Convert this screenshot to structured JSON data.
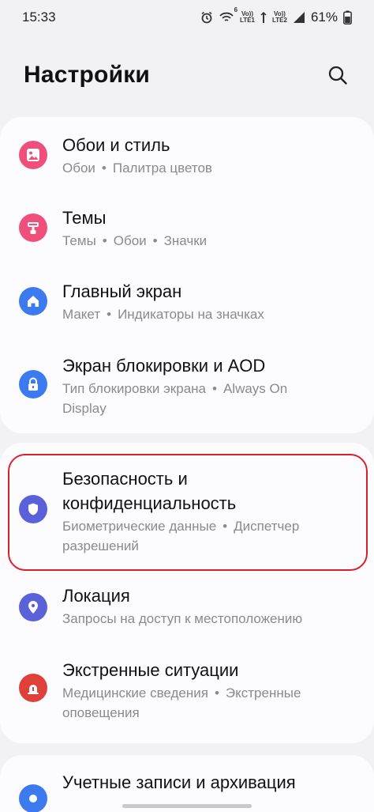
{
  "status_bar": {
    "time": "15:33",
    "network_1": "Vo))",
    "network_1_sub": "LTE1",
    "network_2": "Vo))",
    "network_2_sub": "LTE2",
    "wifi_badge": "6",
    "battery": "61%"
  },
  "header": {
    "title": "Настройки"
  },
  "settings": [
    {
      "title": "Обои и стиль",
      "subtitle": [
        "Обои",
        "Палитра цветов"
      ],
      "icon": "wallpaper-icon",
      "color": "#f04f7c"
    },
    {
      "title": "Темы",
      "subtitle": [
        "Темы",
        "Обои",
        "Значки"
      ],
      "icon": "themes-icon",
      "color": "#f04f7c"
    },
    {
      "title": "Главный экран",
      "subtitle": [
        "Макет",
        "Индикаторы на значках"
      ],
      "icon": "home-icon",
      "color": "#3d7af0"
    },
    {
      "title": "Экран блокировки и AOD",
      "subtitle": [
        "Тип блокировки экрана",
        "Always On"
      ],
      "subtitle_wrap": "Display",
      "icon": "lock-icon",
      "color": "#3d7af0"
    },
    {
      "title": "Безопасность и",
      "title_wrap": "конфиденциальность",
      "subtitle": [
        "Биометрические данные",
        "Диспетчер"
      ],
      "subtitle_wrap": "разрешений",
      "icon": "shield-icon",
      "color": "#5b61d9"
    },
    {
      "title": "Локация",
      "subtitle": [
        "Запросы на доступ к местоположению"
      ],
      "icon": "location-icon",
      "color": "#5b61d9"
    },
    {
      "title": "Экстренные ситуации",
      "subtitle": [
        "Медицинские сведения",
        "Экстренные"
      ],
      "subtitle_wrap": "оповещения",
      "icon": "emergency-icon",
      "color": "#e0403a"
    },
    {
      "title": "Учетные записи и архивация",
      "icon": "accounts-icon",
      "color": "#3d7af0"
    }
  ]
}
